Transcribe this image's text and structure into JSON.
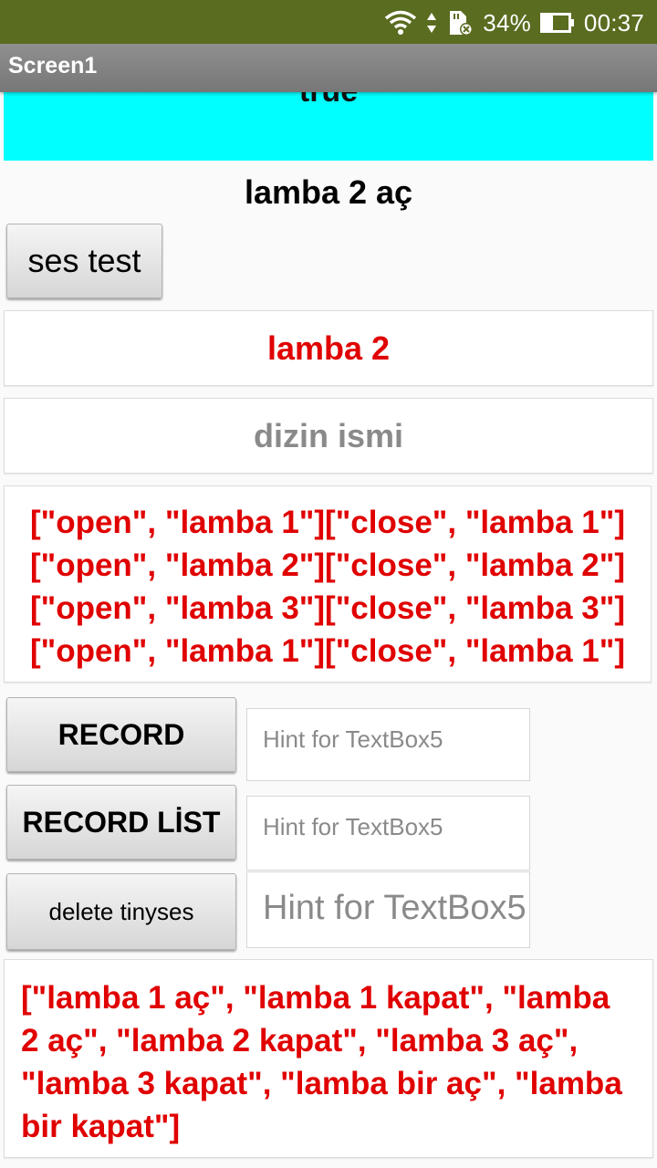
{
  "status_bar": {
    "battery_percent": "34%",
    "time": "00:37",
    "icons": [
      "wifi-icon",
      "data-arrows-icon",
      "sd-card-icon",
      "battery-icon"
    ]
  },
  "app_bar": {
    "title": "Screen1"
  },
  "cyan_label": {
    "text": "true"
  },
  "heading": {
    "text": "lamba 2 aç"
  },
  "buttons": {
    "ses_test": "ses test",
    "record": "RECORD",
    "record_list": "RECORD LİST",
    "delete_tinyses": "delete tinyses"
  },
  "label_lamba": {
    "text": "lamba 2"
  },
  "input_dizin": {
    "placeholder": "dizin ismi"
  },
  "list_box": {
    "lines": [
      "[\"open\", \"lamba 1\"][\"close\", \"lamba 1\"]",
      "[\"open\", \"lamba 2\"][\"close\", \"lamba 2\"]",
      "[\"open\", \"lamba 3\"][\"close\", \"lamba 3\"]",
      "[\"open\", \"lamba 1\"][\"close\", \"lamba 1\"]"
    ]
  },
  "textboxes": {
    "tb1_placeholder": "Hint for TextBox5",
    "tb2_placeholder": "Hint for TextBox5",
    "tb3_placeholder": "Hint for TextBox5"
  },
  "bottom_list": {
    "text": "[\"lamba 1 aç\", \"lamba 1 kapat\", \"lamba 2 aç\", \"lamba 2 kapat\", \"lamba 3 aç\", \"lamba 3 kapat\", \"lamba bir aç\", \"lamba bir kapat\"]"
  },
  "colors": {
    "status_bar": "#5a6c20",
    "app_bar": "#808080",
    "cyan": "#00ffff",
    "red_text": "#e00000"
  }
}
